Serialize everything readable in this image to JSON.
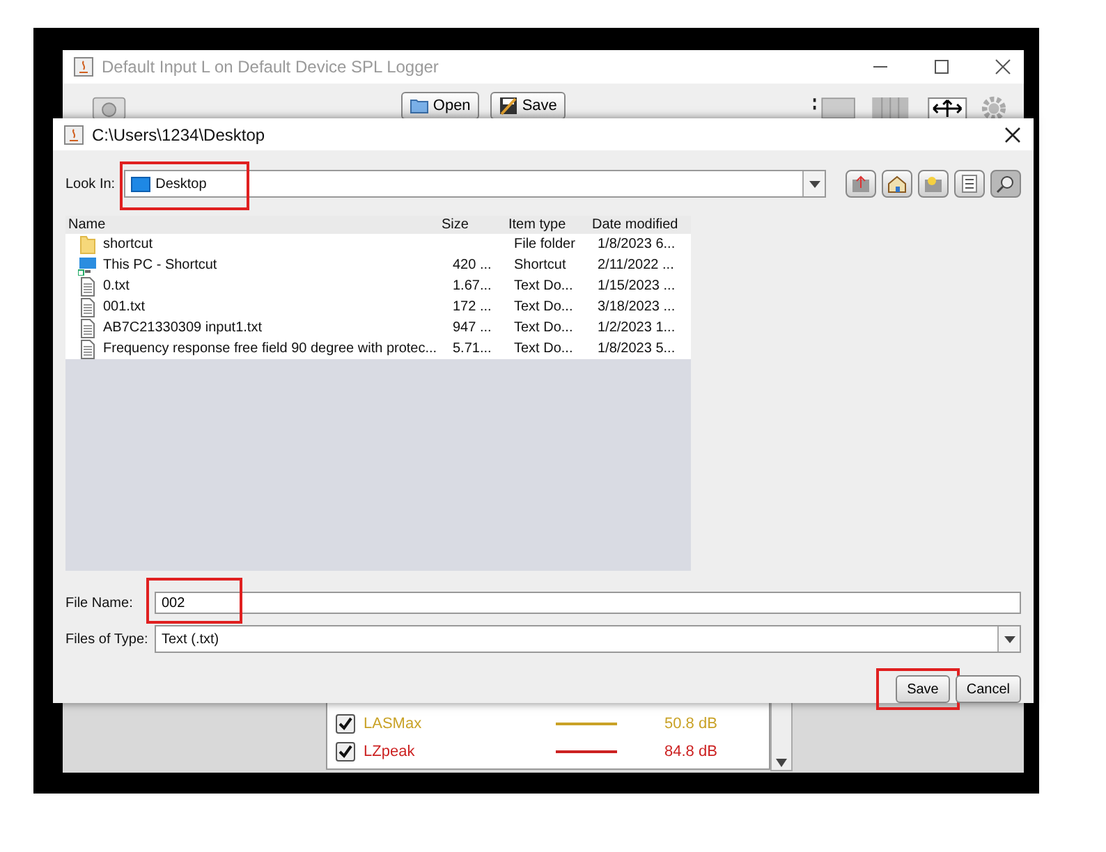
{
  "app_window": {
    "title": "Default Input L on Default Device SPL Logger",
    "toolbar": [
      {
        "label": "Open",
        "kind": "open"
      },
      {
        "label": "Save",
        "kind": "save"
      }
    ]
  },
  "dialog": {
    "title": "C:\\Users\\1234\\Desktop",
    "look_in": {
      "label": "Look In:",
      "value": "Desktop",
      "annotated": true
    },
    "file_list": {
      "columns": [
        "Name",
        "Size",
        "Item type",
        "Date modified"
      ],
      "rows": [
        {
          "kind": "folder",
          "name": "shortcut",
          "type": "File folder",
          "date": "1/8/2023 6..."
        },
        {
          "kind": "computer",
          "name": "This PC - Shortcut",
          "size": "420 ...",
          "type": "Shortcut",
          "date": "2/11/2022 ..."
        },
        {
          "kind": "file",
          "name": "0.txt",
          "size": "1.67...",
          "type": "Text Do...",
          "date": "1/15/2023 ..."
        },
        {
          "kind": "file",
          "name": "001.txt",
          "size": "172 ...",
          "type": "Text Do...",
          "date": "3/18/2023 ..."
        },
        {
          "kind": "file",
          "name": "AB7C21330309 input1.txt",
          "size": "947 ...",
          "type": "Text Do...",
          "date": "1/2/2023 1..."
        },
        {
          "kind": "file",
          "name": "Frequency response free field 90 degree with  protec...",
          "size": "5.71...",
          "type": "Text Do...",
          "date": "1/8/2023 5..."
        }
      ]
    },
    "file_name": {
      "label": "File Name:",
      "value": "002",
      "annotated": true
    },
    "file_type": {
      "label": "Files of Type:",
      "value": "Text (.txt)"
    },
    "buttons": [
      {
        "label": "Save",
        "annotated": true
      },
      {
        "label": "Cancel",
        "annotated": false
      }
    ]
  },
  "legend": [
    {
      "name": "LASMax",
      "value": "50.8 dB",
      "color": "#c9a227",
      "checked": true
    },
    {
      "name": "LZpeak",
      "value": "84.8 dB",
      "color": "#cc2222",
      "checked": true
    }
  ]
}
